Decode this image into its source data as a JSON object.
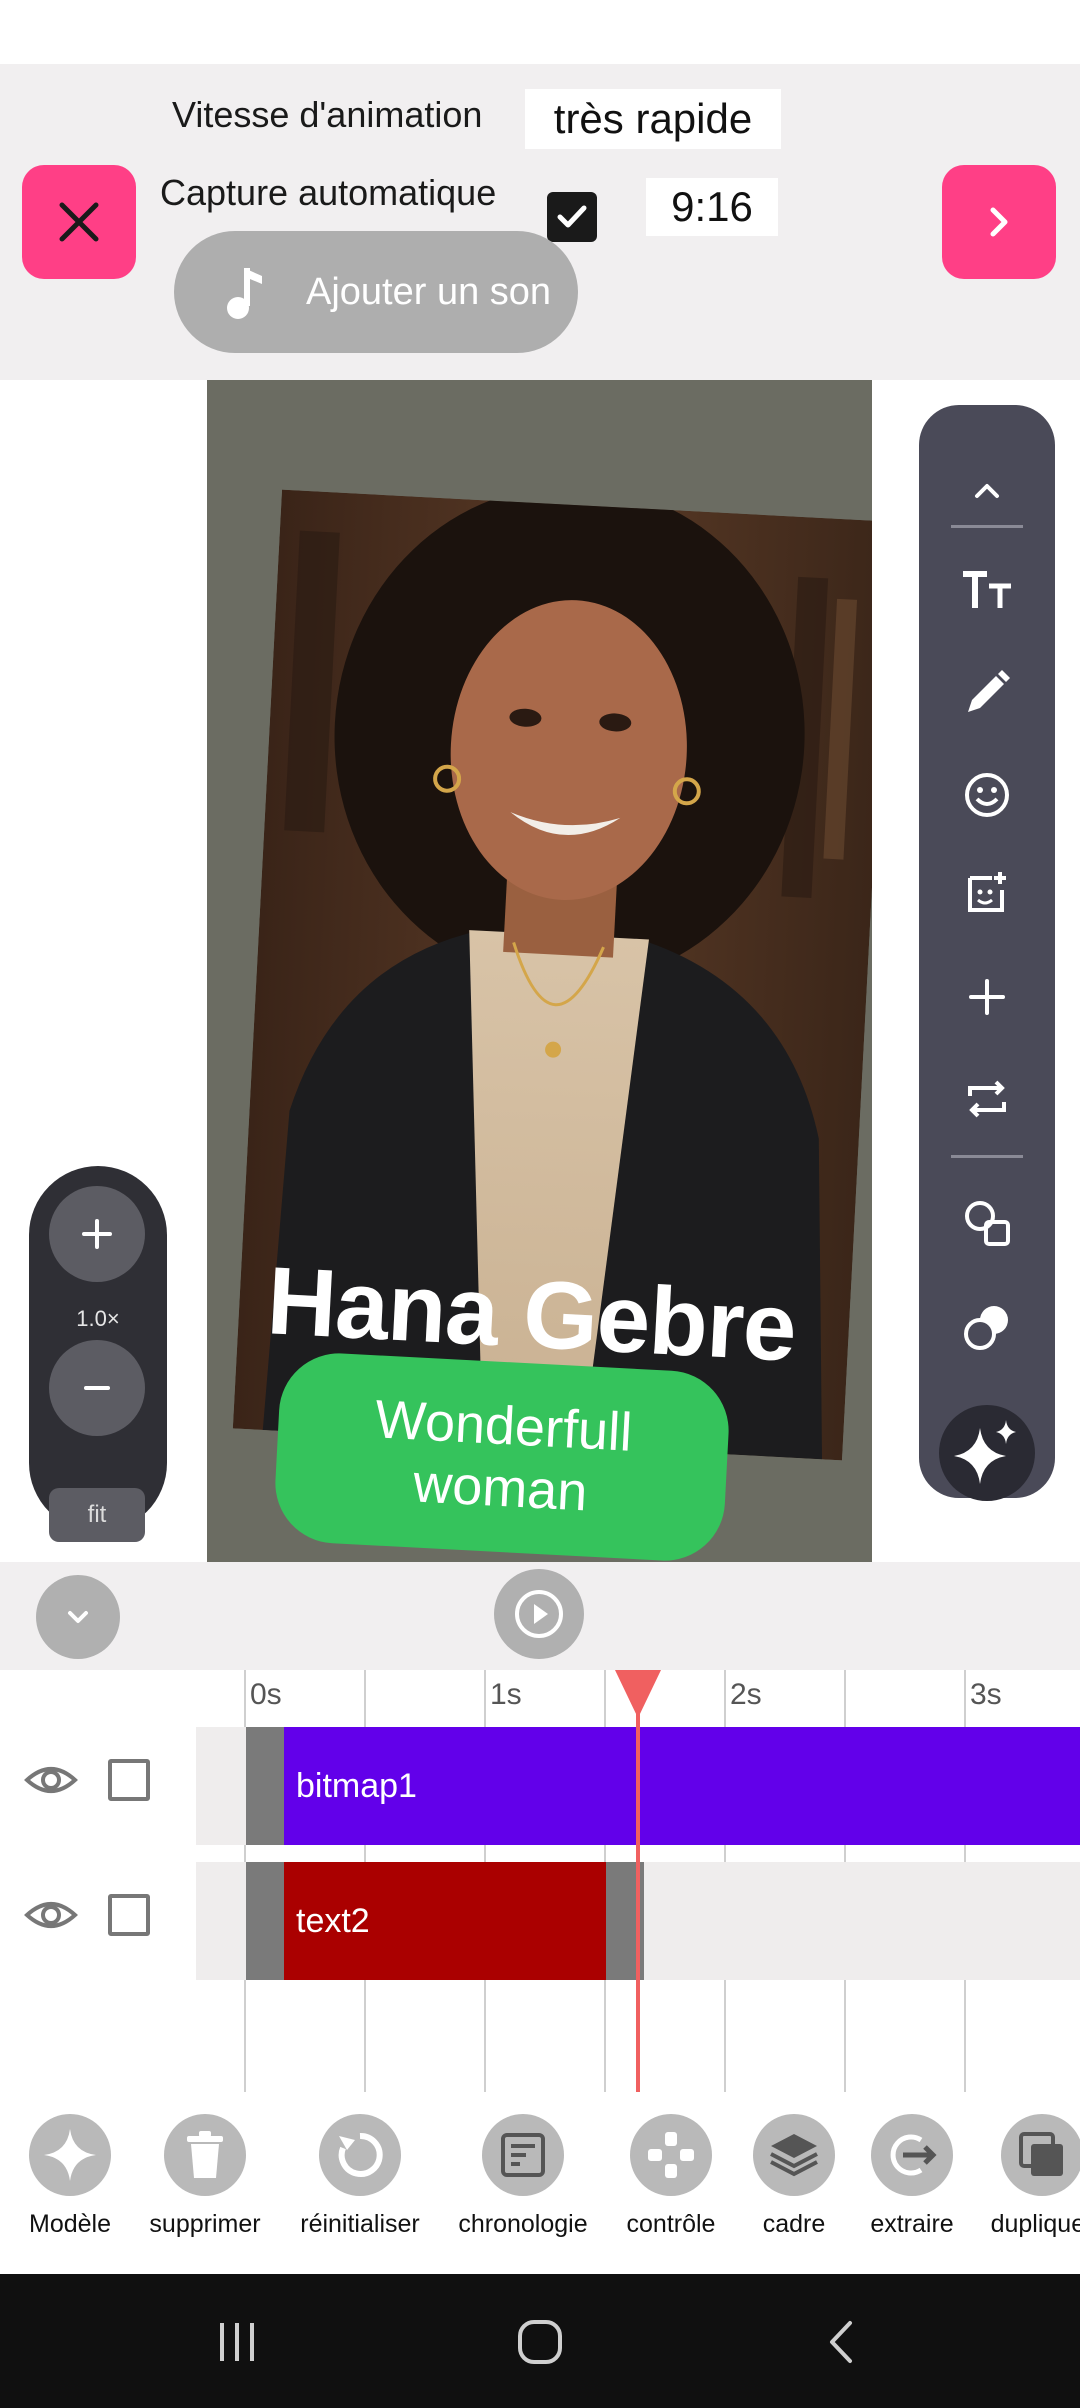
{
  "header": {
    "speed_label": "Vitesse d'animation",
    "speed_value": "très rapide",
    "capture_label": "Capture automatique",
    "capture_checked": true,
    "ratio_value": "9:16",
    "sound_button": "Ajouter un son",
    "close_icon": "close-icon",
    "next_icon": "chevron-right-icon",
    "accent_color": "#ff3f86"
  },
  "canvas": {
    "name_text": "Hana Gebre",
    "badge_text": "Wonderfull woman",
    "badge_color": "#35c35c"
  },
  "zoom": {
    "plus": "+",
    "level": "1.0×",
    "minus": "−",
    "fit": "fit"
  },
  "tools": {
    "icons": [
      "chevron-up-icon",
      "text-size-icon",
      "pencil-icon",
      "emoji-icon",
      "sticker-icon",
      "plus-icon",
      "repeat-icon",
      "shapes-icon",
      "blend-icon",
      "sparkle-icon"
    ]
  },
  "timeline": {
    "ticks": [
      "0s",
      "1s",
      "2s",
      "3s"
    ],
    "tracks": [
      {
        "name": "bitmap1",
        "color": "#6200ea"
      },
      {
        "name": "text2",
        "color": "#aa0000"
      }
    ],
    "playhead_time_s": 1.65
  },
  "actions": [
    {
      "label": "Modèle",
      "icon": "sparkle-icon"
    },
    {
      "label": "supprimer",
      "icon": "trash-icon"
    },
    {
      "label": "réinitialiser",
      "icon": "reset-icon"
    },
    {
      "label": "chronologie",
      "icon": "timeline-icon"
    },
    {
      "label": "contrôle",
      "icon": "gamepad-icon"
    },
    {
      "label": "cadre",
      "icon": "layers-icon"
    },
    {
      "label": "extraire",
      "icon": "export-icon"
    },
    {
      "label": "dupliquer",
      "icon": "duplicate-icon"
    }
  ],
  "navbar": {
    "icons": [
      "recents-icon",
      "home-icon",
      "back-icon"
    ]
  }
}
